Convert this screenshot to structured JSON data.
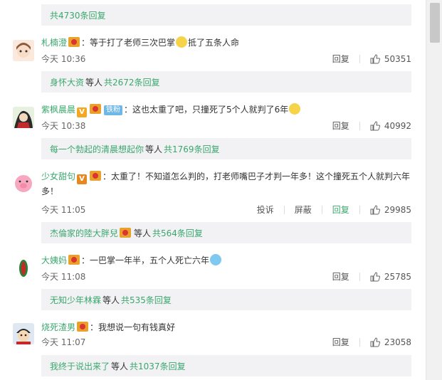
{
  "top": {
    "reply_count": "共4730条回复"
  },
  "comments": [
    {
      "name": "札楠澄",
      "text": "：等于打了老师三次巴掌",
      "text2": "抵了五条人命",
      "time": "今天 10:36",
      "reply_label": "回复",
      "likes": "50351",
      "sub": {
        "user": "身怀大资",
        "mid": "等人",
        "count": "共2672条回复"
      }
    },
    {
      "name": "紫枫晨晨",
      "tag": "铁粉",
      "text": "：这也太重了吧，只撞死了5个人就判了6年",
      "time": "今天 10:38",
      "reply_label": "回复",
      "likes": "40992",
      "sub": {
        "user": "每一个勃起的清晨想起你",
        "mid": "等人",
        "count": "共1769条回复"
      }
    },
    {
      "name": "少女甜句",
      "text": "：太重了！不知道怎么判的，打老师嘴巴子才判一年多！这个撞死五个人就判六年",
      "text_cont": "多！",
      "time": "今天 11:05",
      "report_label": "投诉",
      "block_label": "屏蔽",
      "reply_label": "回复",
      "likes": "29985",
      "sub": {
        "user": "杰倫家的陸大胖兒",
        "mid": "等人",
        "count": "共564条回复"
      }
    },
    {
      "name": "大姨妈",
      "text": "：一巴掌一年半，五个人死亡六年",
      "time": "今天 11:08",
      "reply_label": "回复",
      "likes": "25785",
      "sub": {
        "user": "无知少年林霖",
        "mid": "等人",
        "count": "共535条回复"
      }
    },
    {
      "name": "烧死渣男",
      "text": "：我想说一句有钱真好",
      "time": "今天 11:07",
      "reply_label": "回复",
      "likes": "23058",
      "sub": {
        "user": "我终于说出来了",
        "mid": "等人",
        "count": "共1037条回复"
      }
    }
  ]
}
